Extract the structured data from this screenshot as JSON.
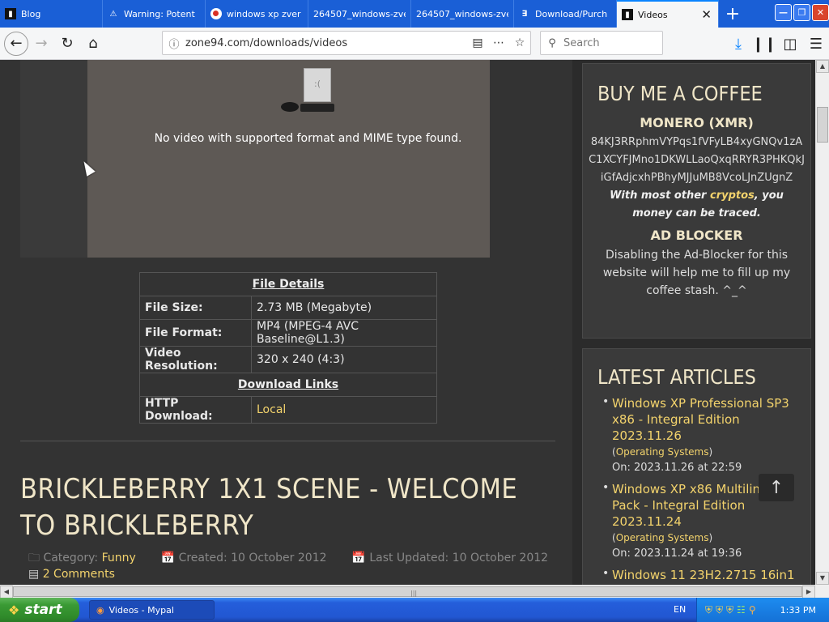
{
  "browser": {
    "tabs": [
      {
        "label": "Blog",
        "icon": "terminal-icon"
      },
      {
        "label": "Warning: Potent",
        "icon": "warning-icon"
      },
      {
        "label": "windows xp zver",
        "icon": "google-icon"
      },
      {
        "label": "264507_windows-zve",
        "icon": "none"
      },
      {
        "label": "264507_windows-zve",
        "icon": "none"
      },
      {
        "label": "Download/Purch",
        "icon": "d-logo-icon"
      },
      {
        "label": "Videos",
        "icon": "terminal-icon",
        "active": true
      }
    ],
    "url": "zone94.com/downloads/videos",
    "search_placeholder": "Search"
  },
  "video": {
    "error_message": "No video with supported format and MIME type found."
  },
  "file_details": {
    "header": "File Details",
    "rows": [
      {
        "key": "File Size:",
        "value": "2.73 MB (Megabyte)"
      },
      {
        "key": "File Format:",
        "value": "MP4 (MPEG-4 AVC Baseline@L1.3)"
      },
      {
        "key": "Video Resolution:",
        "value": "320 x 240 (4:3)"
      }
    ],
    "download_header": "Download Links",
    "download_key": "HTTP Download:",
    "download_value": "Local"
  },
  "article": {
    "title": "BRICKLEBERRY 1X1 SCENE - WELCOME TO BRICKLEBERRY",
    "category_label": "Category:",
    "category_value": "Funny",
    "created": "Created: 10 October 2012",
    "updated": "Last Updated: 10 October 2012",
    "comments": "2 Comments"
  },
  "sidebar": {
    "coffee_title": "BUY ME A COFFEE",
    "monero_title": "MONERO (XMR)",
    "monero_address": "84KJ3RRphmVYPqs1fVFyLB4xyGNQv1zAC1XCYFJMno1DKWLLaoQxqRRYR3PHKQkJiGfAdjcxhPBhyMJJuMB8VcoLJnZUgnZ",
    "note_pre": "With most other ",
    "note_link": "cryptos",
    "note_post": ", you money can be traced.",
    "adblock_title": "AD BLOCKER",
    "adblock_text": "Disabling the Ad-Blocker for this website will help me to fill up my coffee stash. ^_^",
    "latest_title": "LATEST ARTICLES",
    "articles": [
      {
        "title": "Windows XP Professional SP3 x86 - Integral Edition 2023.11.26",
        "category": "Operating Systems",
        "date": "On: 2023.11.26 at 22:59"
      },
      {
        "title": "Windows XP x86 Multilingual Pack - Integral Edition 2023.11.24",
        "category": "Operating Systems",
        "date": "On: 2023.11.24 at 19:36"
      },
      {
        "title": "Windows 11 23H2.2715 16in1",
        "category": "",
        "date": ""
      }
    ]
  },
  "taskbar": {
    "start_label": "start",
    "task_label": "Videos - Mypal",
    "lang": "EN",
    "clock": "1:33 PM"
  }
}
